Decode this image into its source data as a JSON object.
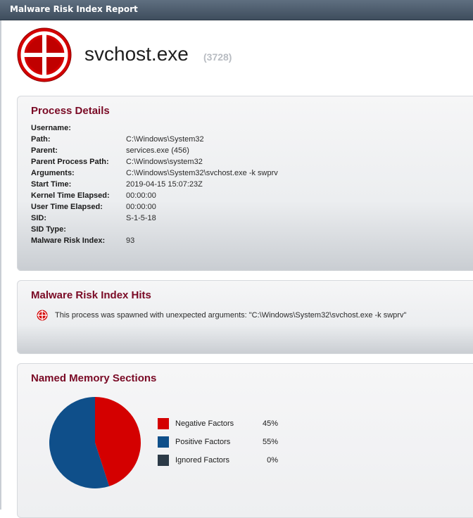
{
  "window": {
    "title": "Malware Risk Index Report"
  },
  "header": {
    "process_name": "svchost.exe",
    "pid": "(3728)"
  },
  "process_details": {
    "heading": "Process Details",
    "rows": [
      {
        "label": "Username:",
        "value": ""
      },
      {
        "label": "Path:",
        "value": "C:\\Windows\\System32"
      },
      {
        "label": "Parent:",
        "value": "services.exe (456)"
      },
      {
        "label": "Parent Process Path:",
        "value": "C:\\Windows\\system32"
      },
      {
        "label": "Arguments:",
        "value": "C:\\Windows\\System32\\svchost.exe -k swprv"
      },
      {
        "label": "Start Time:",
        "value": "2019-04-15 15:07:23Z"
      },
      {
        "label": "Kernel Time Elapsed:",
        "value": "00:00:00"
      },
      {
        "label": "User Time Elapsed:",
        "value": "00:00:00"
      },
      {
        "label": "SID:",
        "value": "S-1-5-18"
      },
      {
        "label": "SID Type:",
        "value": ""
      },
      {
        "label": "Malware Risk Index:",
        "value": "93"
      }
    ]
  },
  "risk_hits": {
    "heading": "Malware Risk Index Hits",
    "items": [
      {
        "text": "This process was spawned with unexpected arguments: \"C:\\Windows\\System32\\svchost.exe -k swprv\""
      }
    ]
  },
  "memory_sections": {
    "heading": "Named Memory Sections",
    "legend": [
      {
        "name": "Negative Factors",
        "value": "45%"
      },
      {
        "name": "Positive Factors",
        "value": "55%"
      },
      {
        "name": "Ignored Factors",
        "value": "0%"
      }
    ]
  },
  "colors": {
    "negative": "#d40000",
    "positive": "#0f4f8a",
    "ignored": "#2c3a47",
    "heading": "#7a0a25"
  },
  "chart_data": {
    "type": "pie",
    "categories": [
      "Negative Factors",
      "Positive Factors",
      "Ignored Factors"
    ],
    "values": [
      45,
      55,
      0
    ],
    "colors": [
      "#d40000",
      "#0f4f8a",
      "#2c3a47"
    ],
    "legend_position": "right"
  }
}
